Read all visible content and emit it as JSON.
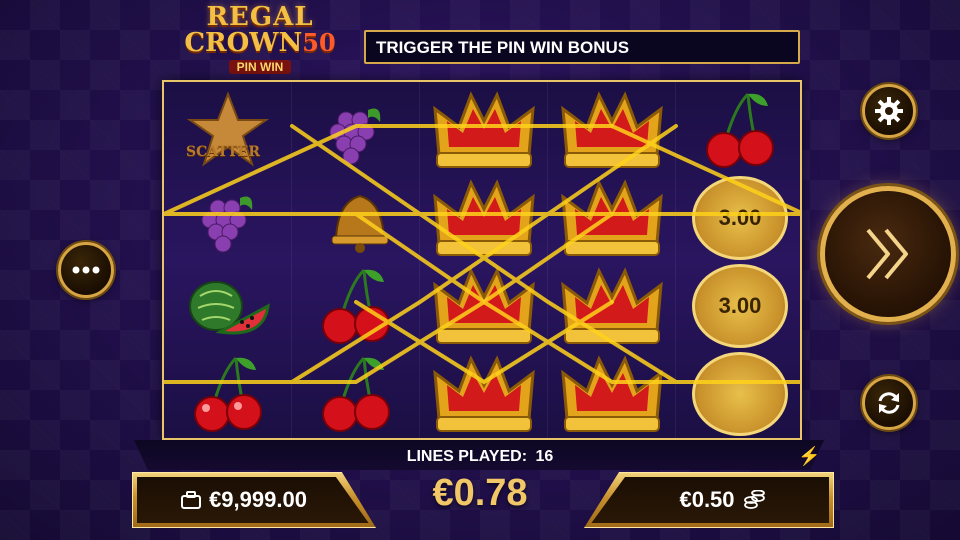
{
  "logo": {
    "line1": "REGAL",
    "line2_word": "CROWN",
    "line2_num": "50",
    "line3": "PIN WIN"
  },
  "message": "TRIGGER THE PIN WIN BONUS",
  "reels": {
    "scatter_label": "SCATTER",
    "coin_values": [
      "3.00",
      "3.00"
    ],
    "symbols": [
      [
        "star-scatter",
        "grapes",
        "watermelon",
        "cherries"
      ],
      [
        "grapes",
        "bell",
        "cherries",
        "cherries"
      ],
      [
        "crown",
        "crown",
        "crown",
        "crown"
      ],
      [
        "crown",
        "crown",
        "crown",
        "crown"
      ],
      [
        "cherries",
        "coin",
        "coin",
        "coin"
      ]
    ]
  },
  "bottom": {
    "lines_label": "LINES PLAYED:",
    "lines_value": "16",
    "total_bet": "€0.78",
    "balance": "€9,999.00",
    "coin_value": "€0.50"
  },
  "icons": {
    "menu": "dots-icon",
    "settings": "gear-icon",
    "spin": "double-chevron-right-icon",
    "autoplay": "refresh-icon",
    "balance": "briefcase-icon",
    "coins": "coin-stack-icon",
    "turbo": "lightning-icon"
  },
  "colors": {
    "gold": "#e2b04c",
    "win_line": "#ffd21a",
    "background": "#23104f",
    "bet_text": "#f2c768"
  }
}
